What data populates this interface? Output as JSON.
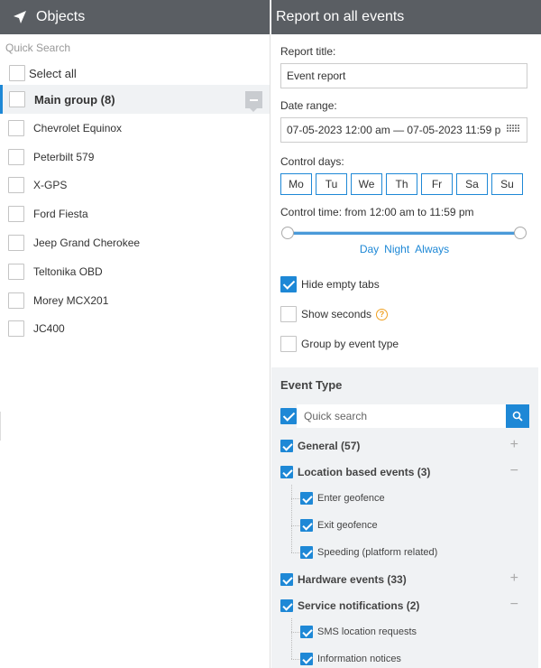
{
  "left_panel": {
    "title": "Objects",
    "search_placeholder": "Quick Search",
    "select_all_label": "Select all",
    "group": {
      "label": "Main group (8)"
    },
    "objects": [
      "Chevrolet Equinox",
      "Peterbilt 579",
      "X-GPS",
      "Ford Fiesta",
      "Jeep Grand Cherokee",
      "Teltonika OBD",
      "Morey MCX201",
      "JC400"
    ]
  },
  "right_panel": {
    "title": "Report on all events",
    "report_title_label": "Report title:",
    "report_title_value": "Event report",
    "date_range_label": "Date range:",
    "date_range_value": "07-05-2023 12:00 am — 07-05-2023 11:59 p",
    "control_days_label": "Control days:",
    "days": [
      "Mo",
      "Tu",
      "We",
      "Th",
      "Fr",
      "Sa",
      "Su"
    ],
    "control_time_label": "Control time: from 12:00 am to 11:59 pm",
    "time_links": [
      "Day",
      "Night",
      "Always"
    ],
    "options": [
      {
        "label": "Hide empty tabs",
        "checked": true
      },
      {
        "label": "Show seconds",
        "checked": false
      },
      {
        "label": "Group by event type",
        "checked": false
      }
    ]
  },
  "event_type": {
    "title": "Event Type",
    "search_placeholder": "Quick search",
    "groups": [
      {
        "label": "General (57)",
        "expanded": false,
        "children": []
      },
      {
        "label": "Location based events (3)",
        "expanded": true,
        "children": [
          "Enter geofence",
          "Exit geofence",
          "Speeding (platform related)"
        ]
      },
      {
        "label": "Hardware events (33)",
        "expanded": false,
        "children": []
      },
      {
        "label": "Service notifications (2)",
        "expanded": true,
        "children": [
          "SMS location requests",
          "Information notices"
        ]
      }
    ]
  },
  "colors": {
    "accent": "#1e88d6",
    "header": "#5a5e63",
    "panel_bg": "#f0f2f4",
    "help": "#f0a020"
  }
}
